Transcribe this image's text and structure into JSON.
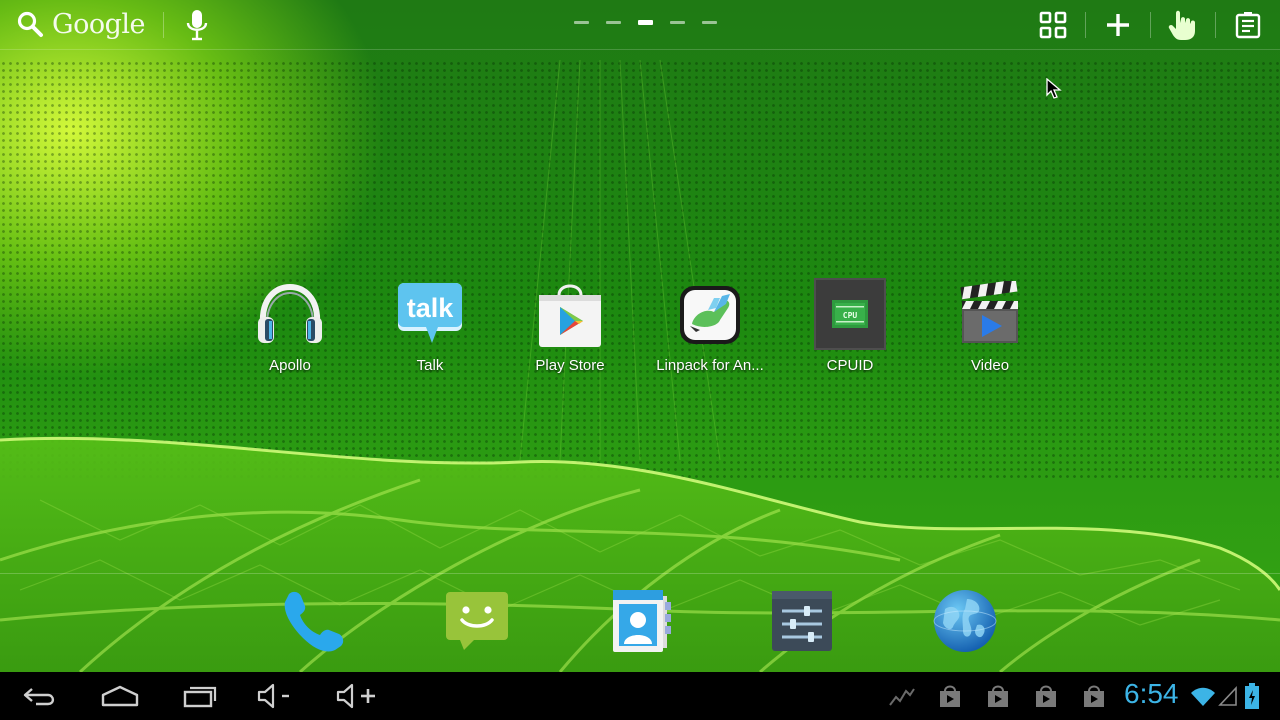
{
  "top_bar": {
    "search_label": "Google",
    "page_count": 5,
    "active_page": 3
  },
  "apps": [
    {
      "label": "Apollo",
      "icon": "apollo-headphones-icon"
    },
    {
      "label": "Talk",
      "icon": "talk-icon"
    },
    {
      "label": "Play Store",
      "icon": "play-store-icon"
    },
    {
      "label": "Linpack for An...",
      "icon": "linpack-icon"
    },
    {
      "label": "CPUID",
      "icon": "cpuid-icon"
    },
    {
      "label": "Video",
      "icon": "video-clapper-icon"
    }
  ],
  "dock": [
    "phone-icon",
    "messaging-icon",
    "contacts-icon",
    "settings-icon",
    "browser-globe-icon"
  ],
  "status_bar": {
    "time": "6:54"
  },
  "colors": {
    "clock_accent": "#3cb4e6",
    "wallpaper_green": "#1f8a12"
  }
}
